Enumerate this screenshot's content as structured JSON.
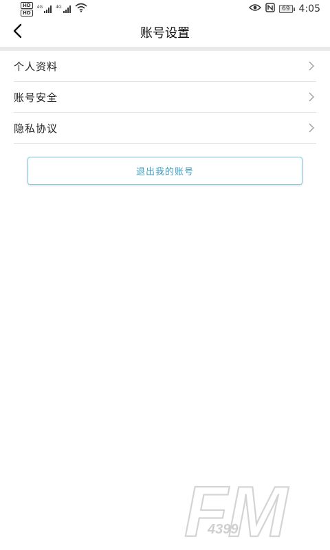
{
  "status_bar": {
    "hd_badges": [
      "HD",
      "HD"
    ],
    "network_tags": [
      "4G",
      "4G"
    ],
    "battery": "69",
    "time": "4:05"
  },
  "header": {
    "title": "账号设置",
    "back_icon": "chevron-left-icon"
  },
  "menu": {
    "items": [
      {
        "label": "个人资料"
      },
      {
        "label": "账号安全"
      },
      {
        "label": "隐私协议"
      }
    ]
  },
  "logout": {
    "label": "退出我的账号"
  },
  "watermark": {
    "brand": "FM",
    "number": "4399"
  },
  "colors": {
    "accent": "#3a9ec2",
    "button_border": "#7ac9df",
    "divider": "#e4e4e4",
    "header_band": "#e9e9e9"
  }
}
